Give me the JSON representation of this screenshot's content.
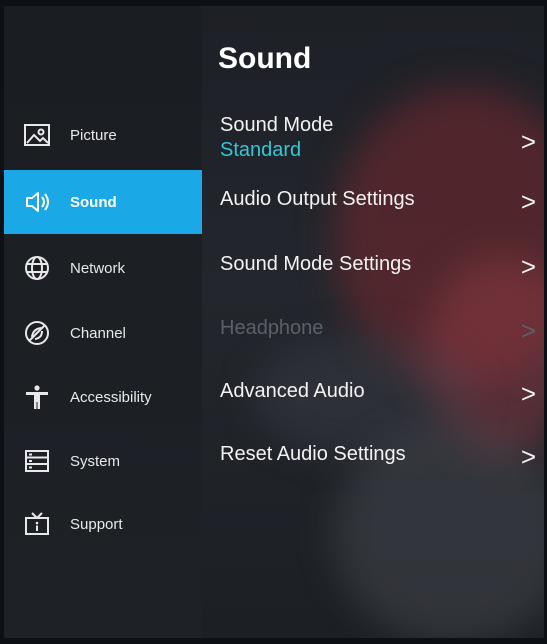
{
  "sidebar": {
    "items": [
      {
        "label": "Picture",
        "icon": "picture-icon"
      },
      {
        "label": "Sound",
        "icon": "speaker-icon"
      },
      {
        "label": "Network",
        "icon": "globe-icon"
      },
      {
        "label": "Channel",
        "icon": "channel-icon"
      },
      {
        "label": "Accessibility",
        "icon": "accessibility-icon"
      },
      {
        "label": "System",
        "icon": "system-icon"
      },
      {
        "label": "Support",
        "icon": "tv-icon"
      }
    ],
    "active_index": 1
  },
  "panel": {
    "title": "Sound",
    "items": [
      {
        "label": "Sound Mode",
        "value": "Standard",
        "enabled": true
      },
      {
        "label": "Audio Output Settings",
        "enabled": true
      },
      {
        "label": "Sound Mode Settings",
        "enabled": true
      },
      {
        "label": "Headphone",
        "enabled": false
      },
      {
        "label": "Advanced Audio",
        "enabled": true
      },
      {
        "label": "Reset Audio Settings",
        "enabled": true
      }
    ],
    "chevron": ">"
  },
  "colors": {
    "accent": "#1aa9e6",
    "value": "#33c6d8",
    "disabled": "#5c6066"
  }
}
